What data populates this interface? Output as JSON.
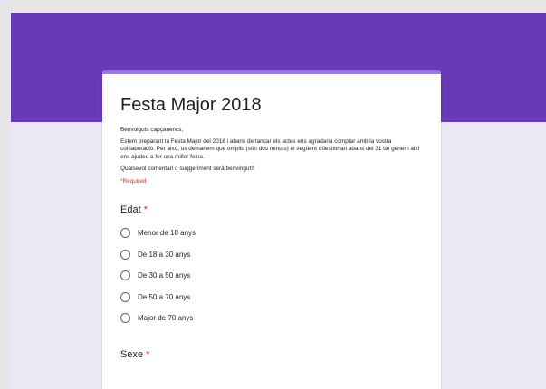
{
  "form": {
    "title": "Festa Major 2018",
    "description": [
      "Benvolguts capçanencs,",
      "Estem preparant la Festa Major del 2018 i abans de tancar els actes ens agradaria comptar amb la vostra col·laboració. Per això, us demanem que ompliu (són dos minuts) el següent qüestionari abans del 31 de gener i així ens ajudeu a fer una millor feina.",
      "Qualsevol comentari o suggeriment serà benvingut!!"
    ],
    "required_note": "*Required",
    "colors": {
      "header": "#673ab7",
      "accent": "#9f77ed",
      "background": "#ece7f5",
      "required": "#d93025"
    }
  },
  "questions": [
    {
      "title": "Edat",
      "required_mark": "*",
      "options": [
        "Menor de 18 anys",
        "De 18 a 30 anys",
        "De 30 a 50 anys",
        "De 50 a 70 anys",
        "Major de 70 anys"
      ]
    },
    {
      "title": "Sexe",
      "required_mark": "*",
      "options": []
    }
  ]
}
